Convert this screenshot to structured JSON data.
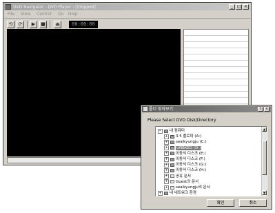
{
  "main_window": {
    "title": "DVD Navigator - DVD Player - [Stopped]",
    "caption_buttons": {
      "minimize": "_",
      "maximize": "□",
      "close": "×"
    },
    "menu": [
      "File",
      "View",
      "Control",
      "Go",
      "Help"
    ],
    "toolbar": {
      "btn1_glyph": "⟲",
      "btn2_glyph": "⟳",
      "play_glyph": "▶",
      "stop_glyph": "■",
      "eject_glyph": "⏏",
      "time": "00:00:00"
    }
  },
  "dialog": {
    "title": "폴더 찾아보기",
    "help_glyph": "?",
    "close_glyph": "×",
    "prompt": "Please Select DVD Disk/Directory",
    "tree": [
      {
        "label": "내 컴퓨터",
        "toggle": "−",
        "indent": 0,
        "icon": "computer"
      },
      {
        "label": "3.5 플로피 (A:)",
        "toggle": "+",
        "indent": 1,
        "icon": "floppy"
      },
      {
        "label": "sealkyungju (C:)",
        "toggle": "+",
        "indent": 1,
        "icon": "drive"
      },
      {
        "label": "UNBKED (D:)",
        "toggle": "+",
        "indent": 1,
        "icon": "cdrom",
        "selected": true
      },
      {
        "label": "이동식 디스크 (E:)",
        "toggle": "+",
        "indent": 1,
        "icon": "removable"
      },
      {
        "label": "이동식 디스크 (F:)",
        "toggle": "+",
        "indent": 1,
        "icon": "removable"
      },
      {
        "label": "이동식 디스크 (G:)",
        "toggle": "+",
        "indent": 1,
        "icon": "removable"
      },
      {
        "label": "이동식 디스크 (H:)",
        "toggle": "+",
        "indent": 1,
        "icon": "removable"
      },
      {
        "label": "공유 문서",
        "toggle": "+",
        "indent": 1,
        "icon": "folder"
      },
      {
        "label": "Guest의 문서",
        "toggle": "+",
        "indent": 1,
        "icon": "folder"
      },
      {
        "label": "sealkyungju의 문서",
        "toggle": "+",
        "indent": 1,
        "icon": "folder"
      },
      {
        "label": "내 네트워크 환경",
        "toggle": "+",
        "indent": 0,
        "icon": "network"
      }
    ],
    "scroll_up_glyph": "▲",
    "scroll_down_glyph": "▼",
    "ok_label": "확인",
    "cancel_label": "취소"
  }
}
